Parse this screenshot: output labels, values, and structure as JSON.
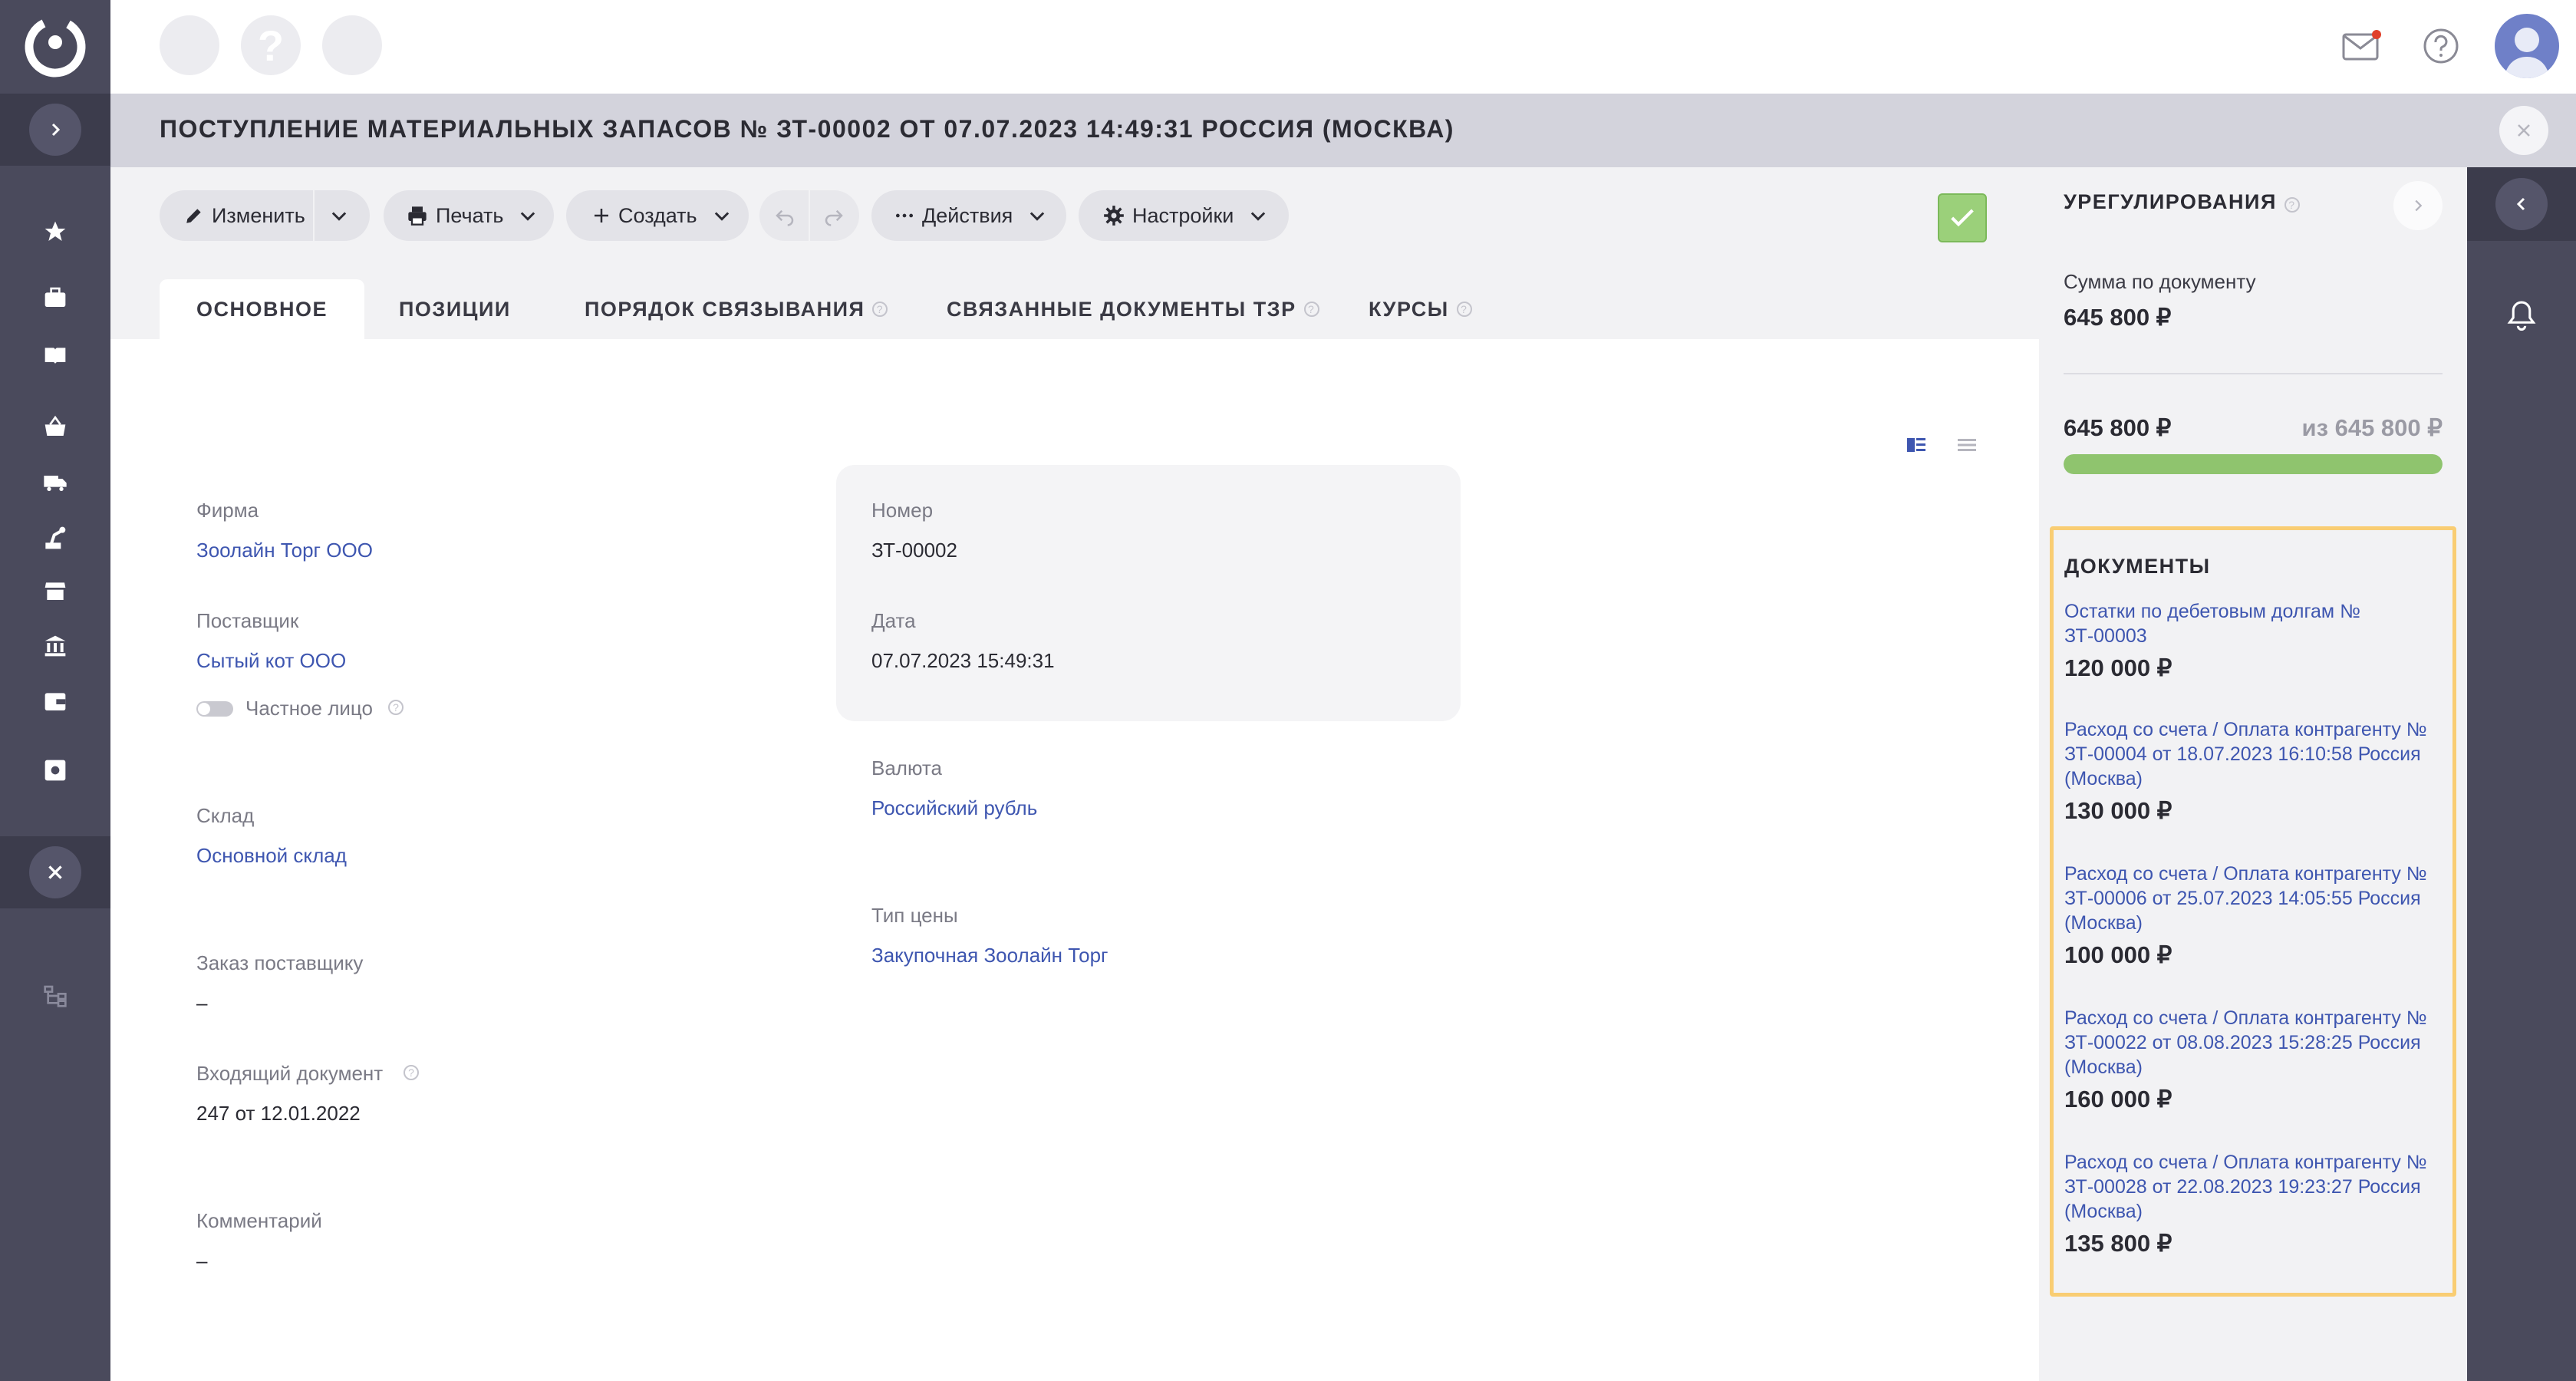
{
  "title_bar": {
    "title": "ПОСТУПЛЕНИЕ МАТЕРИАЛЬНЫХ ЗАПАСОВ № ЗТ-00002 ОТ 07.07.2023 14:49:31 РОССИЯ (МОСКВА)"
  },
  "topbar": {
    "placeholder_glyph": "?",
    "notification_dot_color": "#e0402a"
  },
  "left_nav": {
    "icons": [
      "star-icon",
      "briefcase-icon",
      "book-icon",
      "basket-icon",
      "truck-icon",
      "robot-arm-icon",
      "store-icon",
      "bank-icon",
      "wallet-icon",
      "settings-box-icon",
      "hierarchy-icon"
    ]
  },
  "toolbar": {
    "edit_label": "Изменить",
    "print_label": "Печать",
    "create_label": "Создать",
    "actions_label": "Действия",
    "settings_label": "Настройки"
  },
  "tabs": [
    {
      "label": "ОСНОВНОЕ"
    },
    {
      "label": "ПОЗИЦИИ"
    },
    {
      "label": "ПОРЯДОК СВЯЗЫВАНИЯ"
    },
    {
      "label": "СВЯЗАННЫЕ ДОКУМЕНТЫ ТЗР"
    },
    {
      "label": "КУРСЫ"
    }
  ],
  "form": {
    "firm_label": "Фирма",
    "firm_value": "Зоолайн Торг ООО",
    "supplier_label": "Поставщик",
    "supplier_value": "Сытый кот ООО",
    "private_person_label": "Частное лицо",
    "warehouse_label": "Склад",
    "warehouse_value": "Основной склад",
    "supplier_order_label": "Заказ поставщику",
    "supplier_order_value": "–",
    "incoming_doc_label": "Входящий документ",
    "incoming_doc_value": "247 от 12.01.2022",
    "comment_label": "Комментарий",
    "comment_value": "–",
    "number_label": "Номер",
    "number_value": "ЗТ-00002",
    "date_label": "Дата",
    "date_value": "07.07.2023 15:49:31",
    "currency_label": "Валюта",
    "currency_value": "Российский рубль",
    "price_type_label": "Тип цены",
    "price_type_value": "Закупочная Зоолайн Торг"
  },
  "settlements": {
    "heading": "УРЕГУЛИРОВАНИЯ",
    "doc_sum_label": "Сумма по документу",
    "doc_sum_value": "645 800 ₽",
    "settled_value": "645 800 ₽",
    "settled_of": "из 645 800 ₽",
    "progress_fraction": 1.0,
    "documents_heading": "ДОКУМЕНТЫ",
    "documents": [
      {
        "title": "Остатки по дебетовым долгам № ЗТ-00003",
        "amount": "120 000 ₽"
      },
      {
        "title": "Расход со счета / Оплата контрагенту № ЗТ-00004 от 18.07.2023 16:10:58 Россия (Москва)",
        "amount": "130 000 ₽"
      },
      {
        "title": "Расход со счета / Оплата контрагенту № ЗТ-00006 от 25.07.2023 14:05:55 Россия (Москва)",
        "amount": "100 000 ₽"
      },
      {
        "title": "Расход со счета / Оплата контрагенту № ЗТ-00022 от 08.08.2023 15:28:25 Россия (Москва)",
        "amount": "160 000 ₽"
      },
      {
        "title": "Расход со счета / Оплата контрагенту № ЗТ-00028 от 22.08.2023 19:23:27 Россия (Москва)",
        "amount": "135 800 ₽"
      }
    ]
  },
  "colors": {
    "nav_bg": "#4a4a5c",
    "accent_link": "#3e56b0",
    "progress_fill": "#8fc46e",
    "highlight_border": "#f9cd73",
    "confirm_green": "#9bd07a"
  }
}
